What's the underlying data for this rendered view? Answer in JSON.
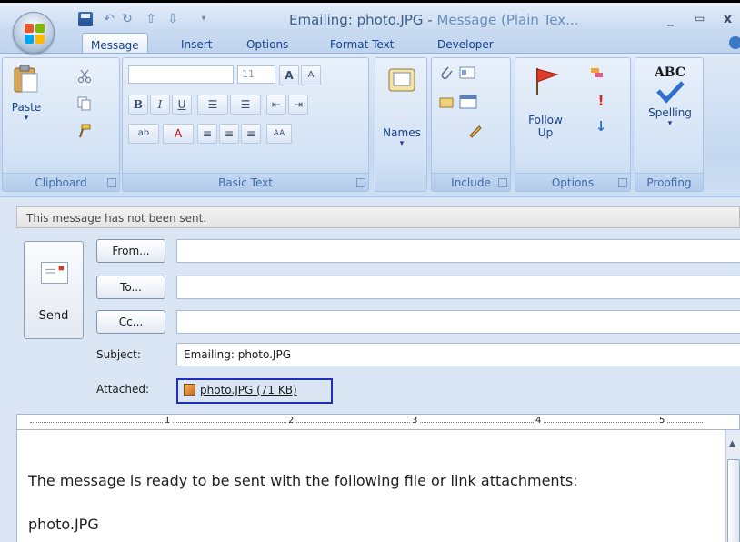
{
  "window": {
    "title_doc": "Emailing: photo.JPG",
    "title_sep": " - ",
    "title_app": "Message (Plain Tex...",
    "minimize": "_",
    "maximize": "▭",
    "close": "x"
  },
  "tabs": [
    "Message",
    "Insert",
    "Options",
    "Format Text",
    "Developer"
  ],
  "ribbon": {
    "clipboard": {
      "paste": "Paste",
      "label": "Clipboard"
    },
    "basic_text": {
      "font_size": "11",
      "bold": "B",
      "italic": "I",
      "underline": "U",
      "label": "Basic Text"
    },
    "names": {
      "label": "Names"
    },
    "include": {
      "label": "Include"
    },
    "options": {
      "follow_up_1": "Follow",
      "follow_up_2": "Up",
      "label": "Options"
    },
    "proofing": {
      "abc": "ABC",
      "spelling": "Spelling",
      "label": "Proofing"
    }
  },
  "message": {
    "notice": "This message has not been sent.",
    "send": "Send",
    "from_btn": "From...",
    "to_btn": "To...",
    "cc_btn": "Cc...",
    "from_value": "",
    "to_value": "",
    "cc_value": "",
    "subject_label": "Subject:",
    "subject_value": "Emailing: photo.JPG",
    "attached_label": "Attached:",
    "attachment": "photo.JPG (71 KB)"
  },
  "ruler": [
    "1",
    "2",
    "3",
    "4",
    "5"
  ],
  "body": {
    "line1": "The message is ready to be sent with the following file or link attachments:",
    "line2": "photo.JPG"
  }
}
